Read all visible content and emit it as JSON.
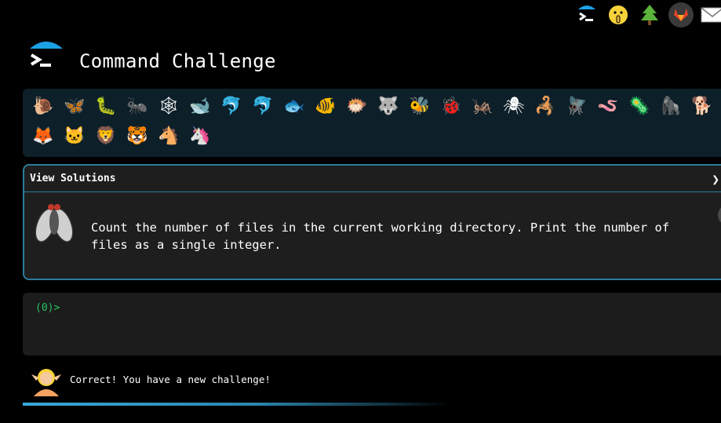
{
  "header": {
    "title": "Command Challenge"
  },
  "top_icons": [
    {
      "name": "terminal-logo-icon"
    },
    {
      "name": "shushing-face-icon",
      "glyph": "🤫"
    },
    {
      "name": "tree-icon",
      "glyph": "🌲"
    },
    {
      "name": "gitlab-icon"
    },
    {
      "name": "mail-icon",
      "glyph": "✉"
    }
  ],
  "emoji_strip": {
    "items": [
      {
        "name": "snail",
        "glyph": "🐌"
      },
      {
        "name": "butterfly",
        "glyph": "🦋"
      },
      {
        "name": "caterpillar",
        "glyph": "🐛"
      },
      {
        "name": "ant",
        "glyph": "🐜"
      },
      {
        "name": "spider-web",
        "glyph": "🕸"
      },
      {
        "name": "whale",
        "glyph": "🐋"
      },
      {
        "name": "dolphin",
        "glyph": "🐬"
      },
      {
        "name": "dolphin-gray",
        "glyph": "🐬"
      },
      {
        "name": "fish",
        "glyph": "🐟"
      },
      {
        "name": "tropical-fish",
        "glyph": "🐠"
      },
      {
        "name": "blowfish",
        "glyph": "🐡"
      },
      {
        "name": "wolf",
        "glyph": "🐺"
      },
      {
        "name": "bee",
        "glyph": "🐝"
      },
      {
        "name": "ladybug",
        "glyph": "🐞"
      },
      {
        "name": "cricket",
        "glyph": "🦗"
      },
      {
        "name": "spider",
        "glyph": "🕷"
      },
      {
        "name": "scorpion",
        "glyph": "🦂"
      },
      {
        "name": "fly",
        "glyph": "🪰"
      },
      {
        "name": "worm",
        "glyph": "🪱"
      },
      {
        "name": "microbe",
        "glyph": "🦠"
      },
      {
        "name": "gorilla",
        "glyph": "🦍"
      },
      {
        "name": "dog",
        "glyph": "🐕"
      },
      {
        "name": "fox",
        "glyph": "🦊"
      },
      {
        "name": "cat",
        "glyph": "🐱"
      },
      {
        "name": "lion",
        "glyph": "🦁"
      },
      {
        "name": "tiger",
        "glyph": "🐯"
      },
      {
        "name": "horse",
        "glyph": "🐴"
      },
      {
        "name": "unicorn",
        "glyph": "🦄"
      }
    ]
  },
  "challenge": {
    "view_solutions_label": "View Solutions",
    "chevron": "❯",
    "description": "Count the number of files in the current working directory. Print the number of files as a single integer."
  },
  "terminal": {
    "prompt": "(0)>",
    "input_value": ""
  },
  "feedback": {
    "message": "Correct! You have a new challenge!"
  },
  "colors": {
    "accent": "#2a7c9a",
    "prompt_green": "#22c55e",
    "strip_bg": "#0d1f29",
    "panel_bg": "#1e1e1e"
  }
}
